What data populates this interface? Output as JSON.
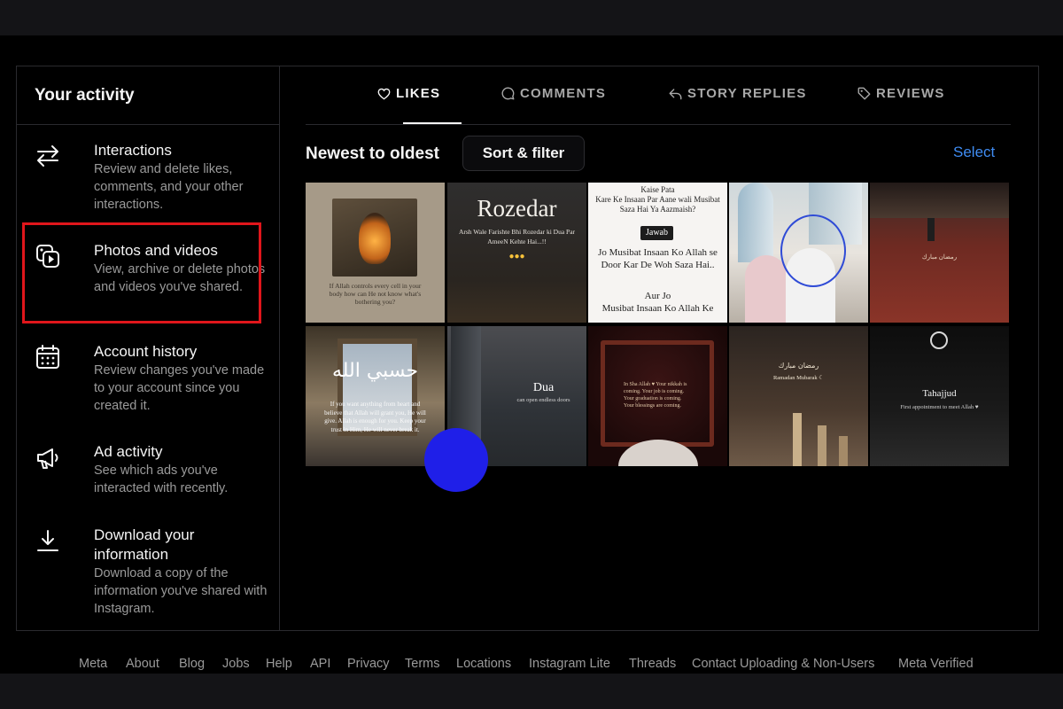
{
  "sidebar": {
    "title": "Your activity",
    "items": [
      {
        "label": "Interactions",
        "desc": "Review and delete likes, comments, and your other interactions.",
        "icon": "arrows-swap-icon"
      },
      {
        "label": "Photos and videos",
        "desc": "View, archive or delete photos and videos you've shared.",
        "icon": "photos-videos-icon"
      },
      {
        "label": "Account history",
        "desc": "Review changes you've made to your account since you created it.",
        "icon": "calendar-icon"
      },
      {
        "label": "Ad activity",
        "desc": "See which ads you've interacted with recently.",
        "icon": "megaphone-icon"
      },
      {
        "label": "Download your information",
        "desc": "Download a copy of the information you've shared with Instagram.",
        "icon": "download-icon"
      }
    ]
  },
  "tabs": [
    {
      "label": "LIKES",
      "icon": "heart-icon",
      "active": true
    },
    {
      "label": "COMMENTS",
      "icon": "comment-icon",
      "active": false
    },
    {
      "label": "STORY REPLIES",
      "icon": "reply-icon",
      "active": false
    },
    {
      "label": "REVIEWS",
      "icon": "tag-icon",
      "active": false
    }
  ],
  "sort": {
    "title": "Newest to oldest",
    "button": "Sort & filter",
    "select": "Select"
  },
  "tiles": {
    "t1": "If Allah controls every cell in your body how can He not know what's bothering you?",
    "t2_title": "Rozedar",
    "t2_sub": "Arsh Wale Farishte Bhi Rozedar ki Dua Par AmeeN Kehte Hai...!!",
    "t3_line1": "Kaise Pata",
    "t3_line2": "Kare Ke Insaan Par Aane wali Musibat Saza Hai Ya Aazmaish?",
    "t3_badge": "Jawab",
    "t3_line3": "Jo Musibat Insaan Ko Allah se Door Kar De Woh Saza Hai..",
    "t3_line4": "Aur Jo",
    "t3_line5": "Musibat Insaan Ko Allah Ke",
    "t5_arabic": "رمضان مبارك",
    "t6_arabic": "حسبي الله",
    "t6_text": "If you want anything from heart and believe that Allah will grant you, He will give. Allah is enough for you. Keep your trust in Him, He will never break it.",
    "t7_title": "Dua",
    "t7_sub": "can open endless doors",
    "t8_text": "In Sha Allah ♥ Your nikkah is coming. Your job is coming. Your graduation is coming. Your blessings are coming.",
    "t9_arabic": "رمضان مبارك",
    "t9_text": "Ramadan Mubarak ☾",
    "t10_title": "Tahajjud",
    "t10_sub": "First appointment to meet Allah ♥"
  },
  "footer": [
    "Meta",
    "About",
    "Blog",
    "Jobs",
    "Help",
    "API",
    "Privacy",
    "Terms",
    "Locations",
    "Instagram Lite",
    "Threads",
    "Contact Uploading & Non-Users",
    "Meta Verified"
  ],
  "colors": {
    "accent": "#3f8cf2",
    "highlight": "#e0161b",
    "background": "#000000"
  }
}
